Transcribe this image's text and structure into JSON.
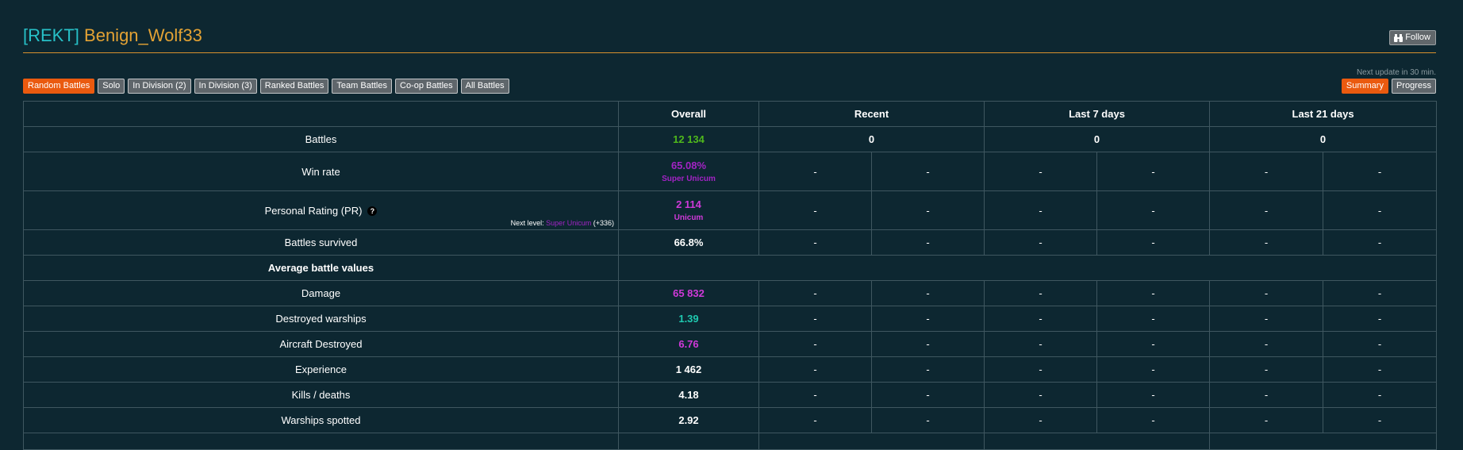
{
  "header": {
    "clan_tag": "[REKT]",
    "nickname": "Benign_Wolf33",
    "follow_label": "Follow"
  },
  "next_update": "Next update in 30 min.",
  "tabs": [
    {
      "label": "Random Battles",
      "active": true
    },
    {
      "label": "Solo",
      "active": false
    },
    {
      "label": "In Division (2)",
      "active": false
    },
    {
      "label": "In Division (3)",
      "active": false
    },
    {
      "label": "Ranked Battles",
      "active": false
    },
    {
      "label": "Team Battles",
      "active": false
    },
    {
      "label": "Co-op Battles",
      "active": false
    },
    {
      "label": "All Battles",
      "active": false
    }
  ],
  "view_tabs": [
    {
      "label": "Summary",
      "active": true
    },
    {
      "label": "Progress",
      "active": false
    }
  ],
  "columns": [
    "Overall",
    "Recent",
    "Last 7 days",
    "Last 21 days"
  ],
  "rows": {
    "battles": {
      "label": "Battles",
      "overall": "12 134",
      "recent": "0",
      "last7": "0",
      "last21": "0"
    },
    "win_rate": {
      "label": "Win rate",
      "overall": "65.08%",
      "rating": "Super Unicum"
    },
    "pr": {
      "label": "Personal Rating (PR)",
      "overall": "2 114",
      "rating": "Unicum",
      "help": "?",
      "next_level_prefix": "Next level:",
      "next_level_name": "Super Unicum",
      "next_level_delta": "(+336)"
    },
    "survived": {
      "label": "Battles survived",
      "overall": "66.8%"
    },
    "avg_section": {
      "label": "Average battle values"
    },
    "damage": {
      "label": "Damage",
      "overall": "65 832"
    },
    "destroyed": {
      "label": "Destroyed warships",
      "overall": "1.39"
    },
    "aircraft": {
      "label": "Aircraft Destroyed",
      "overall": "6.76"
    },
    "experience": {
      "label": "Experience",
      "overall": "1 462"
    },
    "kd": {
      "label": "Kills / deaths",
      "overall": "4.18"
    },
    "spotted": {
      "label": "Warships spotted",
      "overall": "2.92"
    }
  },
  "dash": "-",
  "colors": {
    "background": "#0d2731",
    "clan_tag": "#27c0c7",
    "nickname": "#e3a234",
    "active_tab": "#ea5a0f",
    "super_unicum": "#a223c4",
    "unicum": "#cf39d9",
    "good": "#4fb81c",
    "teal": "#1fc9b0"
  }
}
